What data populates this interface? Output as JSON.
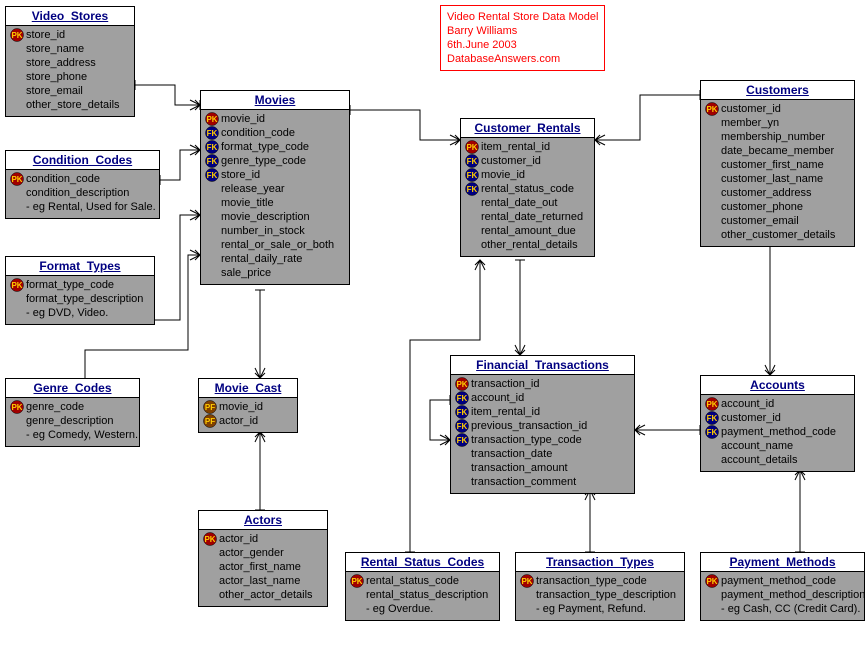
{
  "note": {
    "line1": "Video Rental Store Data Model",
    "line2": "Barry Williams",
    "line3": "6th.June 2003",
    "line4": "DatabaseAnswers.com"
  },
  "entities": {
    "video_stores": {
      "title": "Video_Stores",
      "rows": [
        {
          "k": "pk",
          "t": "store_id"
        },
        {
          "k": "",
          "t": "store_name"
        },
        {
          "k": "",
          "t": "store_address"
        },
        {
          "k": "",
          "t": "store_phone"
        },
        {
          "k": "",
          "t": "store_email"
        },
        {
          "k": "",
          "t": "other_store_details"
        }
      ]
    },
    "movies": {
      "title": "Movies",
      "rows": [
        {
          "k": "pk",
          "t": "movie_id"
        },
        {
          "k": "fk",
          "t": "condition_code"
        },
        {
          "k": "fk",
          "t": "format_type_code"
        },
        {
          "k": "fk",
          "t": "genre_type_code"
        },
        {
          "k": "fk",
          "t": "store_id"
        },
        {
          "k": "",
          "t": "release_year"
        },
        {
          "k": "",
          "t": "movie_title"
        },
        {
          "k": "",
          "t": "movie_description"
        },
        {
          "k": "",
          "t": "number_in_stock"
        },
        {
          "k": "",
          "t": "rental_or_sale_or_both"
        },
        {
          "k": "",
          "t": "rental_daily_rate"
        },
        {
          "k": "",
          "t": "sale_price"
        }
      ]
    },
    "condition_codes": {
      "title": "Condition_Codes",
      "rows": [
        {
          "k": "pk",
          "t": "condition_code"
        },
        {
          "k": "",
          "t": "condition_description"
        },
        {
          "k": "",
          "t": "- eg Rental, Used for Sale."
        }
      ]
    },
    "format_types": {
      "title": "Format_Types",
      "rows": [
        {
          "k": "pk",
          "t": "format_type_code"
        },
        {
          "k": "",
          "t": "format_type_description"
        },
        {
          "k": "",
          "t": "- eg DVD, Video."
        }
      ]
    },
    "genre_codes": {
      "title": "Genre_Codes",
      "rows": [
        {
          "k": "pk",
          "t": "genre_code"
        },
        {
          "k": "",
          "t": "genre_description"
        },
        {
          "k": "",
          "t": "- eg Comedy, Western."
        }
      ]
    },
    "movie_cast": {
      "title": "Movie_Cast",
      "rows": [
        {
          "k": "pf",
          "t": "movie_id"
        },
        {
          "k": "pf",
          "t": "actor_id"
        }
      ]
    },
    "actors": {
      "title": "Actors",
      "rows": [
        {
          "k": "pk",
          "t": "actor_id"
        },
        {
          "k": "",
          "t": "actor_gender"
        },
        {
          "k": "",
          "t": "actor_first_name"
        },
        {
          "k": "",
          "t": "actor_last_name"
        },
        {
          "k": "",
          "t": "other_actor_details"
        }
      ]
    },
    "customer_rentals": {
      "title": "Customer_Rentals",
      "rows": [
        {
          "k": "pk",
          "t": "item_rental_id"
        },
        {
          "k": "fk",
          "t": "customer_id"
        },
        {
          "k": "fk",
          "t": "movie_id"
        },
        {
          "k": "fk",
          "t": "rental_status_code"
        },
        {
          "k": "",
          "t": "rental_date_out"
        },
        {
          "k": "",
          "t": "rental_date_returned"
        },
        {
          "k": "",
          "t": "rental_amount_due"
        },
        {
          "k": "",
          "t": "other_rental_details"
        }
      ]
    },
    "customers": {
      "title": "Customers",
      "rows": [
        {
          "k": "pk",
          "t": "customer_id"
        },
        {
          "k": "",
          "t": "member_yn"
        },
        {
          "k": "",
          "t": "membership_number"
        },
        {
          "k": "",
          "t": "date_became_member"
        },
        {
          "k": "",
          "t": "customer_first_name"
        },
        {
          "k": "",
          "t": "customer_last_name"
        },
        {
          "k": "",
          "t": "customer_address"
        },
        {
          "k": "",
          "t": "customer_phone"
        },
        {
          "k": "",
          "t": "customer_email"
        },
        {
          "k": "",
          "t": "other_customer_details"
        }
      ]
    },
    "financial_transactions": {
      "title": "Financial_Transactions",
      "rows": [
        {
          "k": "pk",
          "t": "transaction_id"
        },
        {
          "k": "fk",
          "t": "account_id"
        },
        {
          "k": "fk",
          "t": "item_rental_id"
        },
        {
          "k": "fk",
          "t": "previous_transaction_id"
        },
        {
          "k": "fk",
          "t": "transaction_type_code"
        },
        {
          "k": "",
          "t": "transaction_date"
        },
        {
          "k": "",
          "t": "transaction_amount"
        },
        {
          "k": "",
          "t": "transaction_comment"
        }
      ]
    },
    "accounts": {
      "title": "Accounts",
      "rows": [
        {
          "k": "pk",
          "t": "account_id"
        },
        {
          "k": "fk",
          "t": "customer_id"
        },
        {
          "k": "fk",
          "t": "payment_method_code"
        },
        {
          "k": "",
          "t": "account_name"
        },
        {
          "k": "",
          "t": "account_details"
        }
      ]
    },
    "rental_status_codes": {
      "title": "Rental_Status_Codes",
      "rows": [
        {
          "k": "pk",
          "t": "rental_status_code"
        },
        {
          "k": "",
          "t": "rental_status_description"
        },
        {
          "k": "",
          "t": "- eg Overdue."
        }
      ]
    },
    "transaction_types": {
      "title": "Transaction_Types",
      "rows": [
        {
          "k": "pk",
          "t": "transaction_type_code"
        },
        {
          "k": "",
          "t": "transaction_type_description"
        },
        {
          "k": "",
          "t": "- eg Payment, Refund."
        }
      ]
    },
    "payment_methods": {
      "title": "Payment_Methods",
      "rows": [
        {
          "k": "pk",
          "t": "payment_method_code"
        },
        {
          "k": "",
          "t": "payment_method_description"
        },
        {
          "k": "",
          "t": "- eg Cash, CC (Credit Card)."
        }
      ]
    }
  }
}
